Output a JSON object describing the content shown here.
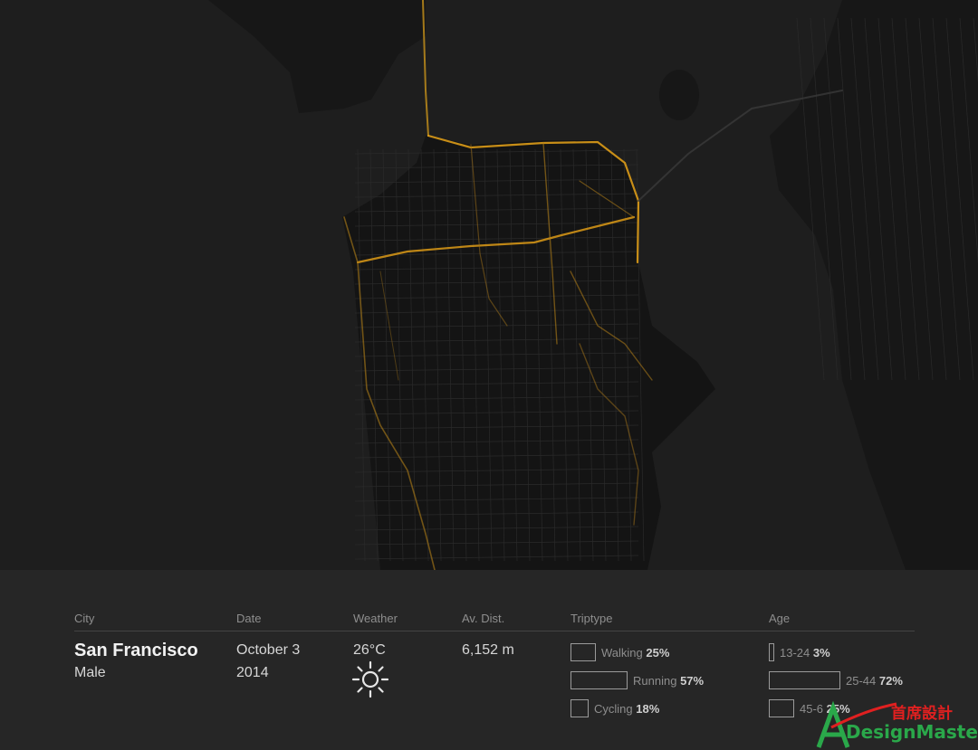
{
  "map": {
    "description_icon": "route-heatmap",
    "route_color": "#e8a317",
    "water_color": "#232323",
    "land_color": "#1a1a1a"
  },
  "panel": {
    "city_header": "City",
    "date_header": "Date",
    "weather_header": "Weather",
    "dist_header": "Av. Dist.",
    "triptype_header": "Triptype",
    "age_header": "Age",
    "city": "San Francisco",
    "gender": "Male",
    "date_line1": "October 3",
    "date_line2": "2014",
    "temperature": "26°C",
    "weather_icon": "sun-icon",
    "distance": "6,152 m",
    "triptypes": [
      {
        "label": "Walking",
        "pct_text": "25%",
        "pct": 25
      },
      {
        "label": "Running",
        "pct_text": "57%",
        "pct": 57
      },
      {
        "label": "Cycling",
        "pct_text": "18%",
        "pct": 18
      }
    ],
    "ages": [
      {
        "label": "13-24",
        "pct_text": "3%",
        "pct": 3
      },
      {
        "label": "25-44",
        "pct_text": "72%",
        "pct": 72
      },
      {
        "label": "45-6",
        "pct_text": "25%",
        "pct": 25
      }
    ]
  },
  "watermark": {
    "chinese": "首席設計",
    "brand": "DesignMaster"
  }
}
